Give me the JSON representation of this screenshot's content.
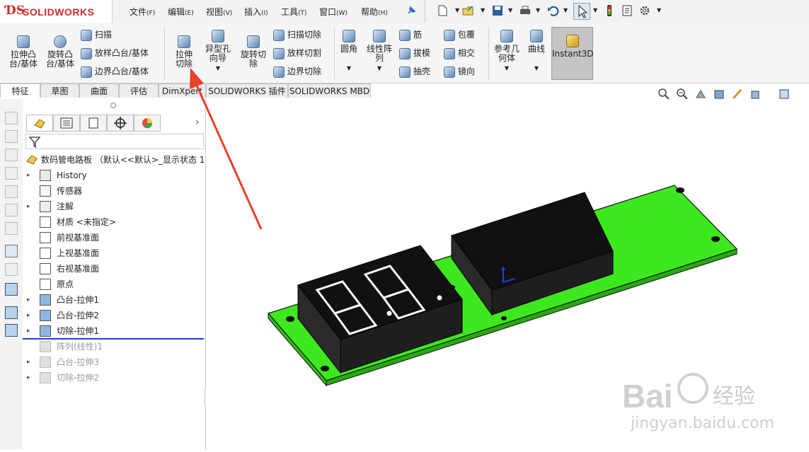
{
  "app": {
    "brand": "SOLIDWORKS",
    "brand_color": "#d12a2a"
  },
  "menus": [
    {
      "label": "文件",
      "key": "(F)"
    },
    {
      "label": "编辑",
      "key": "(E)"
    },
    {
      "label": "视图",
      "key": "(V)"
    },
    {
      "label": "插入",
      "key": "(I)"
    },
    {
      "label": "工具",
      "key": "(T)"
    },
    {
      "label": "窗口",
      "key": "(W)"
    },
    {
      "label": "帮助",
      "key": "(H)"
    }
  ],
  "ribbon": {
    "extrude_boss": "拉伸凸台/基体",
    "revolve_boss": "旋转凸台/基体",
    "sweep": "扫描",
    "loft_boss": "放样凸台/基体",
    "boundary_boss": "边界凸台/基体",
    "extrude_cut": "拉伸切除",
    "hole_wizard": "异型孔向导",
    "revolve_cut": "旋转切除",
    "swept_cut": "扫描切除",
    "lofted_cut": "放样切割",
    "boundary_cut": "边界切除",
    "fillet": "圆角",
    "linear_pattern": "线性阵列",
    "rib": "筋",
    "draft": "拔模",
    "shell": "抽壳",
    "wrap": "包覆",
    "intersect": "相交",
    "mirror": "镜向",
    "ref_geometry": "参考几何体",
    "curves": "曲线",
    "instant3d": "Instant3D"
  },
  "tabs": [
    "特征",
    "草图",
    "曲面",
    "评估",
    "DimXpert",
    "SOLIDWORKS 插件",
    "SOLIDWORKS MBD"
  ],
  "tree": {
    "root": "数码管电路板 （默认<<默认>_显示状态 1>",
    "items": [
      {
        "label": "History",
        "arrow": true,
        "gray": false
      },
      {
        "label": "传感器",
        "arrow": false,
        "gray": false
      },
      {
        "label": "注解",
        "arrow": true,
        "gray": false
      },
      {
        "label": "材质 <未指定>",
        "arrow": false,
        "gray": false
      },
      {
        "label": "前视基准面",
        "arrow": false,
        "gray": false
      },
      {
        "label": "上视基准面",
        "arrow": false,
        "gray": false
      },
      {
        "label": "右视基准面",
        "arrow": false,
        "gray": false
      },
      {
        "label": "原点",
        "arrow": false,
        "gray": false
      },
      {
        "label": "凸台-拉伸1",
        "arrow": true,
        "gray": false
      },
      {
        "label": "凸台-拉伸2",
        "arrow": true,
        "gray": false
      },
      {
        "label": "切除-拉伸1",
        "arrow": true,
        "gray": false
      },
      {
        "label": "阵列(线性)1",
        "arrow": false,
        "gray": true
      },
      {
        "label": "凸台-拉伸3",
        "arrow": true,
        "gray": true
      },
      {
        "label": "切除-拉伸2",
        "arrow": true,
        "gray": true
      }
    ]
  },
  "colors": {
    "pcb_green": "#3ee81e",
    "annotation_arrow": "#e8402a",
    "rollback_bar": "#1f3fd6"
  },
  "watermark": {
    "brand": "Bai",
    "cn": "经验",
    "url": "jingyan.baidu.com"
  }
}
